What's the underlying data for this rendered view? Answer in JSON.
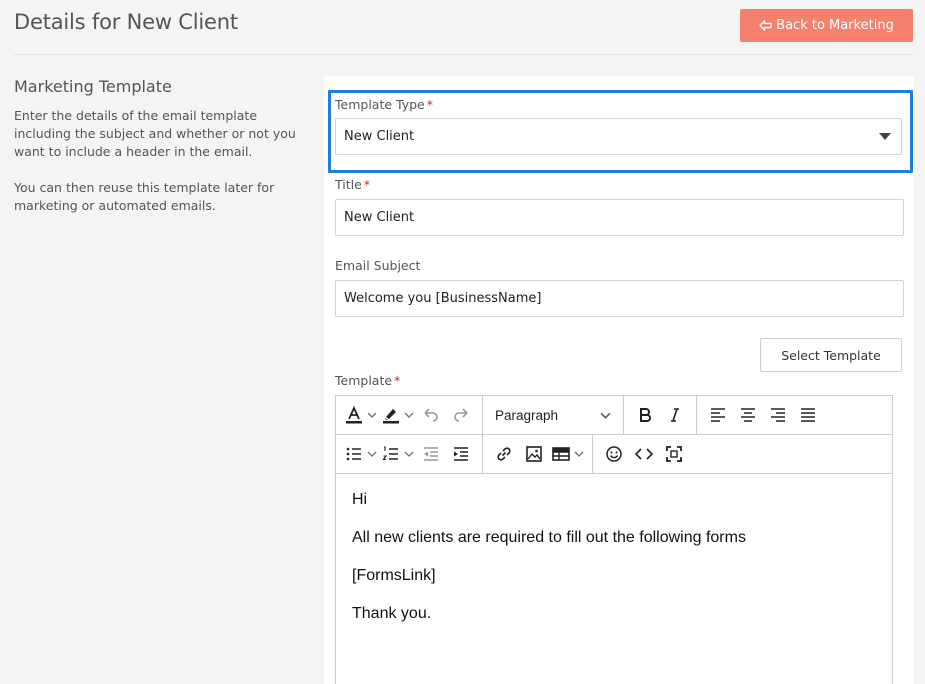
{
  "header": {
    "title": "Details for New Client",
    "back_button_label": "Back to Marketing"
  },
  "sidebar": {
    "title": "Marketing Template",
    "description_1": "Enter the details of the email template including the subject and whether or not you want to include a header in the email.",
    "description_2": "You can then reuse this template later for marketing or automated emails."
  },
  "form": {
    "template_type": {
      "label": "Template Type",
      "required_mark": "*",
      "value": "New Client"
    },
    "title": {
      "label": "Title",
      "required_mark": "*",
      "value": "New Client"
    },
    "email_subject": {
      "label": "Email Subject",
      "value": "Welcome you [BusinessName]"
    },
    "select_template_label": "Select Template",
    "template": {
      "label": "Template",
      "required_mark": "*"
    }
  },
  "editor": {
    "block_format": "Paragraph",
    "toolbar_icons": [
      "text-color-icon",
      "highlight-icon",
      "undo-icon",
      "redo-icon",
      "bold-icon",
      "italic-icon",
      "align-left-icon",
      "align-center-icon",
      "align-right-icon",
      "align-justify-icon",
      "bullet-list-icon",
      "numbered-list-icon",
      "outdent-icon",
      "indent-icon",
      "link-icon",
      "image-icon",
      "table-icon",
      "emoji-icon",
      "source-code-icon",
      "fullscreen-icon"
    ],
    "content": [
      "Hi",
      "All new clients are required to fill out the following forms",
      "[FormsLink]",
      "Thank you."
    ]
  },
  "colors": {
    "accent_button": "#f4806d",
    "focus_outline": "#1a7fe0",
    "required": "#d9281f"
  }
}
